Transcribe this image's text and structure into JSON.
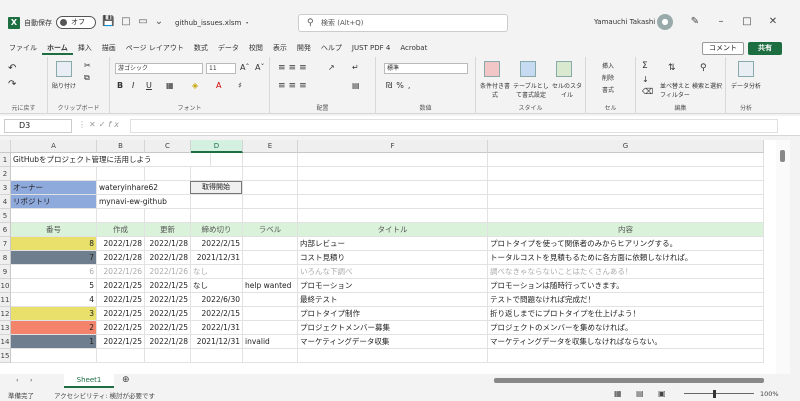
{
  "titlebar": {
    "autosave_label": "自動保存",
    "autosave_state": "オフ",
    "filename": "github_issues.xlsm ・",
    "search_placeholder": "検索 (Alt+Q)",
    "username": "Yamauchi Takashi"
  },
  "tabs": [
    "ファイル",
    "ホーム",
    "挿入",
    "描画",
    "ページ レイアウト",
    "数式",
    "データ",
    "校閲",
    "表示",
    "開発",
    "ヘルプ",
    "JUST PDF 4",
    "Acrobat"
  ],
  "active_tab_index": 1,
  "actions": {
    "comment": "コメント",
    "share": "共有"
  },
  "ribbon": {
    "groups": [
      "元に戻す",
      "クリップボード",
      "フォント",
      "配置",
      "数値",
      "スタイル",
      "セル",
      "編集",
      "分析"
    ],
    "paste": "貼り付け",
    "font_name": "游ゴシック",
    "font_size": "11",
    "number_format": "標準",
    "styles": [
      "条件付き書式",
      "テーブルとして書式設定",
      "セルのスタイル"
    ],
    "cells": [
      "挿入",
      "削除",
      "書式"
    ],
    "edit": [
      "並べ替えとフィルター",
      "検索と選択"
    ],
    "analysis": "データ分析"
  },
  "formula": {
    "namebox": "D3",
    "content": ""
  },
  "columns": [
    "A",
    "B",
    "C",
    "D",
    "E",
    "F",
    "G"
  ],
  "selected_column": "D",
  "row_numbers": [
    "1",
    "2",
    "3",
    "4",
    "5",
    "6",
    "7",
    "8",
    "9",
    "10",
    "11",
    "12",
    "13",
    "14",
    "15"
  ],
  "sheet": {
    "title": "GitHubをプロジェクト管理に活用しよう",
    "owner_label": "オーナー",
    "owner_value": "wateryinhare62",
    "repo_label": "リポジトリ",
    "repo_value": "mynavi-ew-github",
    "fetch_button": "取得開始",
    "table_headers": [
      "番号",
      "作成",
      "更新",
      "締め切り",
      "ラベル",
      "タイトル",
      "内容"
    ],
    "rows": [
      {
        "num": "8",
        "created": "2022/1/28",
        "updated": "2022/1/28",
        "deadline": "2022/2/15",
        "label": "",
        "title": "内部レビュー",
        "content": "プロトタイプを使って関係者のみからヒアリングする。",
        "color": "#e8e06a",
        "gray": false
      },
      {
        "num": "7",
        "created": "2022/1/28",
        "updated": "2022/1/28",
        "deadline": "2021/12/31",
        "label": "",
        "title": "コスト見積り",
        "content": "トータルコストを見積もるために各方面に依頼しなければ。",
        "color": "#6f7e8e",
        "gray": false
      },
      {
        "num": "6",
        "created": "2022/1/26",
        "updated": "2022/1/26",
        "deadline": "なし",
        "label": "",
        "title": "いろんな下調べ",
        "content": "調べなきゃならないことはたくさんある！",
        "color": "",
        "gray": true
      },
      {
        "num": "5",
        "created": "2022/1/25",
        "updated": "2022/1/25",
        "deadline": "なし",
        "label": "help wanted",
        "title": "プロモーション",
        "content": "プロモーションは随時行っていきます。",
        "color": "",
        "gray": false
      },
      {
        "num": "4",
        "created": "2022/1/25",
        "updated": "2022/1/25",
        "deadline": "2022/6/30",
        "label": "",
        "title": "最終テスト",
        "content": "テストで問題なければ完成だ！",
        "color": "",
        "gray": false
      },
      {
        "num": "3",
        "created": "2022/1/25",
        "updated": "2022/1/25",
        "deadline": "2022/2/15",
        "label": "",
        "title": "プロトタイプ制作",
        "content": "折り返しまでにプロトタイプを仕上げよう！",
        "color": "#e8e06a",
        "gray": false
      },
      {
        "num": "2",
        "created": "2022/1/25",
        "updated": "2022/1/25",
        "deadline": "2022/1/31",
        "label": "",
        "title": "プロジェクトメンバー募集",
        "content": "プロジェクトのメンバーを集めなければ。",
        "color": "#f4836b",
        "gray": false
      },
      {
        "num": "1",
        "created": "2022/1/25",
        "updated": "2022/1/28",
        "deadline": "2021/12/31",
        "label": "invalid",
        "title": "マーケティングデータ収集",
        "content": "マーケティングデータを収集しなければならない。",
        "color": "#6f7e8e",
        "gray": false
      }
    ]
  },
  "sheettab": "Sheet1",
  "status": {
    "ready": "準備完了",
    "accessibility": "アクセシビリティ: 検討が必要です",
    "zoom": "100%"
  }
}
